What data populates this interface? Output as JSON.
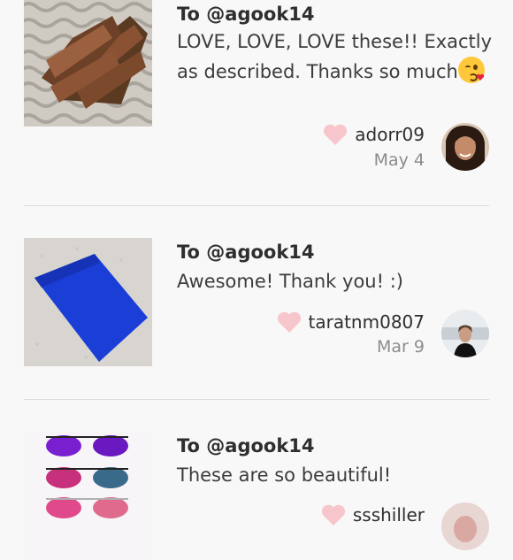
{
  "reviews": [
    {
      "recipient": "To @agook14",
      "message": "LOVE, LOVE, LOVE these!! Exactly as described. Thanks so much",
      "emoji": "kissing-face-emoji",
      "username": "adorr09",
      "date": "May 4",
      "item_image": "brown-sandals-photo",
      "avatar": "user-avatar-adorr09"
    },
    {
      "recipient": "To @agook14",
      "message": "Awesome! Thank you! :)",
      "username": "taratnm0807",
      "date": "Mar 9",
      "item_image": "blue-skirt-photo",
      "avatar": "user-avatar-taratnm0807"
    },
    {
      "recipient": "To @agook14",
      "message": "These are so beautiful!",
      "username": "ssshiller",
      "date": "",
      "item_image": "sunglasses-photo",
      "avatar": "user-avatar-ssshiller"
    }
  ],
  "colors": {
    "heart": "#f7c5cc",
    "divider": "#dcdcdc",
    "background": "#f9f8f8"
  }
}
